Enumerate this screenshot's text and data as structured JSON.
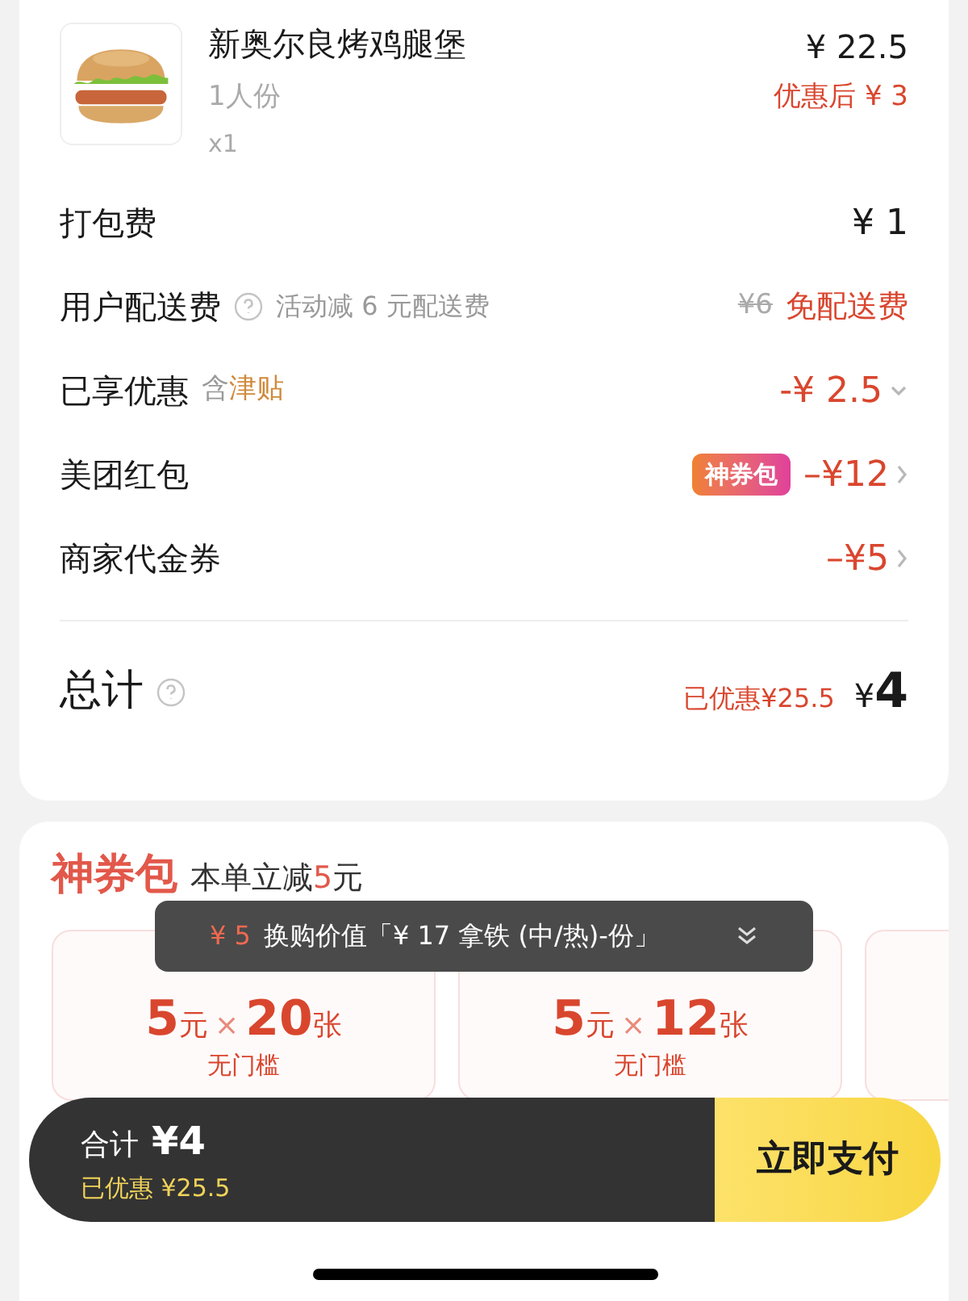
{
  "item": {
    "name": "新奥尔良烤鸡腿堡",
    "spec": "1人份",
    "quantity": "x1",
    "price": "¥ 22.5",
    "discounted": "优惠后 ¥ 3"
  },
  "fees": [
    {
      "kind": "plain",
      "label": "打包费",
      "value": "¥ 1"
    },
    {
      "kind": "delivery",
      "label": "用户配送费",
      "note": "活动减 6 元配送费",
      "original": "¥6",
      "value": "免配送费"
    },
    {
      "kind": "discount",
      "label": "已享优惠",
      "prefix": "含",
      "highlight": "津贴",
      "value": "-¥ 2.5"
    },
    {
      "kind": "coupon",
      "label": "美团红包",
      "badge": "神券包",
      "value": "–¥12"
    },
    {
      "kind": "coupon",
      "label": "商家代金券",
      "value": "–¥5"
    }
  ],
  "total": {
    "label": "总计",
    "saved": "已优惠¥25.5",
    "currency": "¥",
    "amount": "4"
  },
  "coupon_pack": {
    "title": "神券包",
    "subtitle": "本单立减",
    "subtitle_amount": "5",
    "subtitle_unit": "元",
    "coupons": [
      {
        "amount": "5",
        "unit": "元",
        "times": "×",
        "count": "20",
        "count_unit": "张",
        "condition": "无门槛"
      },
      {
        "amount": "5",
        "unit": "元",
        "times": "×",
        "count": "12",
        "count_unit": "张",
        "condition": "无门槛"
      }
    ]
  },
  "toast": {
    "price": "¥ 5",
    "text": "换购价值「¥ 17 拿铁 (中/热)-份」"
  },
  "checkout": {
    "label": "合计",
    "amount": "¥4",
    "saved": "已优惠 ¥25.5",
    "button": "立即支付"
  }
}
